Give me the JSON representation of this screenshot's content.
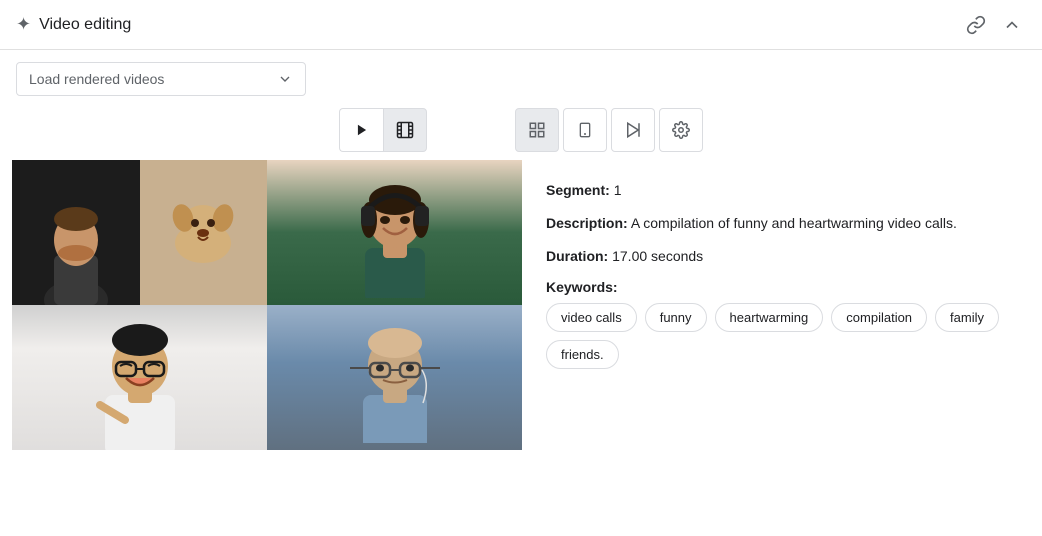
{
  "header": {
    "title": "Video editing",
    "icon": "✦",
    "link_icon": "🔗",
    "collapse_icon": "∧"
  },
  "toolbar": {
    "load_dropdown_label": "Load rendered videos",
    "load_dropdown_placeholder": "Load rendered videos"
  },
  "controls": {
    "play_label": "▶",
    "film_label": "▦",
    "grid_label": "▦",
    "mobile_label": "📱",
    "preview_label": "▶",
    "settings_label": "⚙"
  },
  "segment": {
    "segment_label": "Segment:",
    "segment_value": "1",
    "description_label": "Description:",
    "description_value": "A compilation of funny and heartwarming video calls.",
    "duration_label": "Duration:",
    "duration_value": "17.00 seconds",
    "keywords_label": "Keywords:",
    "keywords": [
      "video calls",
      "funny",
      "heartwarming",
      "compilation",
      "family",
      "friends."
    ]
  }
}
